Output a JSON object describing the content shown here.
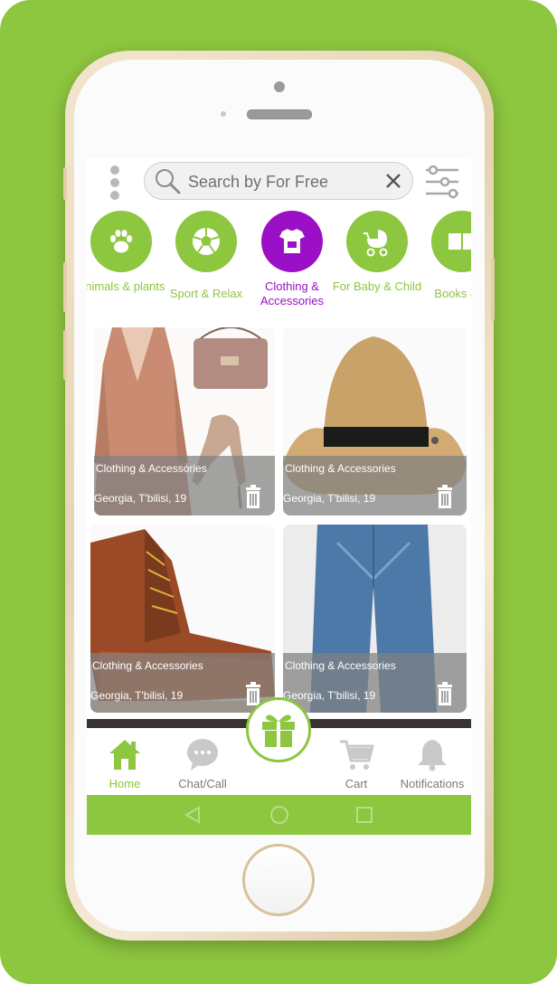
{
  "search": {
    "placeholder": "Search by For Free"
  },
  "categories": [
    {
      "label": "Animals & plants",
      "icon": "paw-icon",
      "active": false
    },
    {
      "label": "Sport & Relax",
      "icon": "soccer-ball-icon",
      "active": false
    },
    {
      "label": "Clothing & Accessories",
      "icon": "clothing-icon",
      "active": true
    },
    {
      "label": "For Baby & Child",
      "icon": "stroller-icon",
      "active": false
    },
    {
      "label": "Books & C",
      "icon": "books-icon",
      "active": false
    }
  ],
  "listings": [
    {
      "category": "Clothing & Accessories",
      "location": "Georgia, T'bilisi, 19",
      "image": "dress-heels-bag-image"
    },
    {
      "category": "Clothing & Accessories",
      "location": "Georgia, T'bilisi, 19",
      "image": "straw-hat-image"
    },
    {
      "category": "Clothing & Accessories",
      "location": "Georgia, T'bilisi, 19",
      "image": "work-boots-image"
    },
    {
      "category": "Clothing & Accessories",
      "location": "Georgia, T'bilisi, 19",
      "image": "jeans-image"
    }
  ],
  "tabs": [
    {
      "label": "Home",
      "icon": "home-icon"
    },
    {
      "label": "Chat/Call",
      "icon": "chat-icon"
    },
    {
      "label": "Cart",
      "icon": "cart-icon"
    },
    {
      "label": "Notifications",
      "icon": "bell-icon"
    }
  ],
  "colors": {
    "accent": "#8dc63f",
    "active": "#9b10c6",
    "overlay": "#808080"
  }
}
